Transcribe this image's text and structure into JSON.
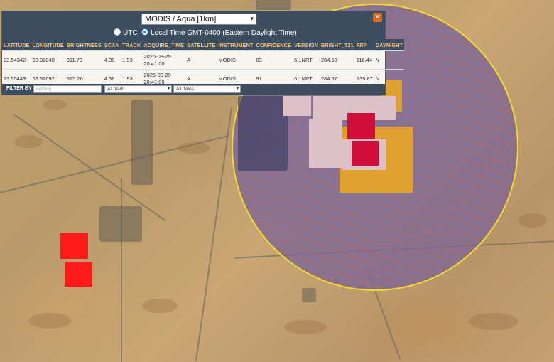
{
  "selector": {
    "value": "MODIS / Aqua [1km]"
  },
  "timezone": {
    "utc_label": "UTC",
    "local_label": "Local Time GMT-0400 (Eastern Daylight Time)",
    "selected": "local"
  },
  "table": {
    "headers": [
      "LATITUDE",
      "LONGITUDE",
      "BRIGHTNESS",
      "SCAN",
      "TRACK",
      "ACQUIRE_TIME",
      "SATELLITE",
      "INSTRUMENT",
      "CONFIDENCE",
      "VERSION",
      "BRIGHT_T31",
      "FRP",
      "DAYNIGHT"
    ],
    "rows": [
      {
        "latitude": "23.54342",
        "longitude": "53.32840",
        "brightness": "311.73",
        "scan": "4.38",
        "track": "1.93",
        "date": "2026-03-29",
        "time": "20:41:00",
        "satellite": "A",
        "instrument": "MODIS",
        "confidence": "83",
        "version": "6.1NRT",
        "bright_t31": "284.69",
        "frp": "116.44",
        "daynight": "N"
      },
      {
        "latitude": "23.55443",
        "longitude": "53.32692",
        "brightness": "315.26",
        "scan": "4.38",
        "track": "1.93",
        "date": "2026-03-29",
        "time": "20:41:00",
        "satellite": "A",
        "instrument": "MODIS",
        "confidence": "91",
        "version": "6.1NRT",
        "bright_t31": "284.87",
        "frp": "139.87",
        "daynight": "N"
      }
    ]
  },
  "filter": {
    "label": "FILTER BY",
    "placeholder": "nothing",
    "fields": "All fields",
    "dates": "All dates"
  },
  "colors": {
    "panel_header": "#3c4d60",
    "header_text": "#f2c37a",
    "fire_red": "#ff1a1a",
    "fire_dark": "#d0103a",
    "halo_orange": "#e0a030",
    "circle_border": "#f0dc2a",
    "close_button": "#e06a1a"
  },
  "icons": {
    "close": "close-icon",
    "dropdown": "chevron-down-icon"
  }
}
